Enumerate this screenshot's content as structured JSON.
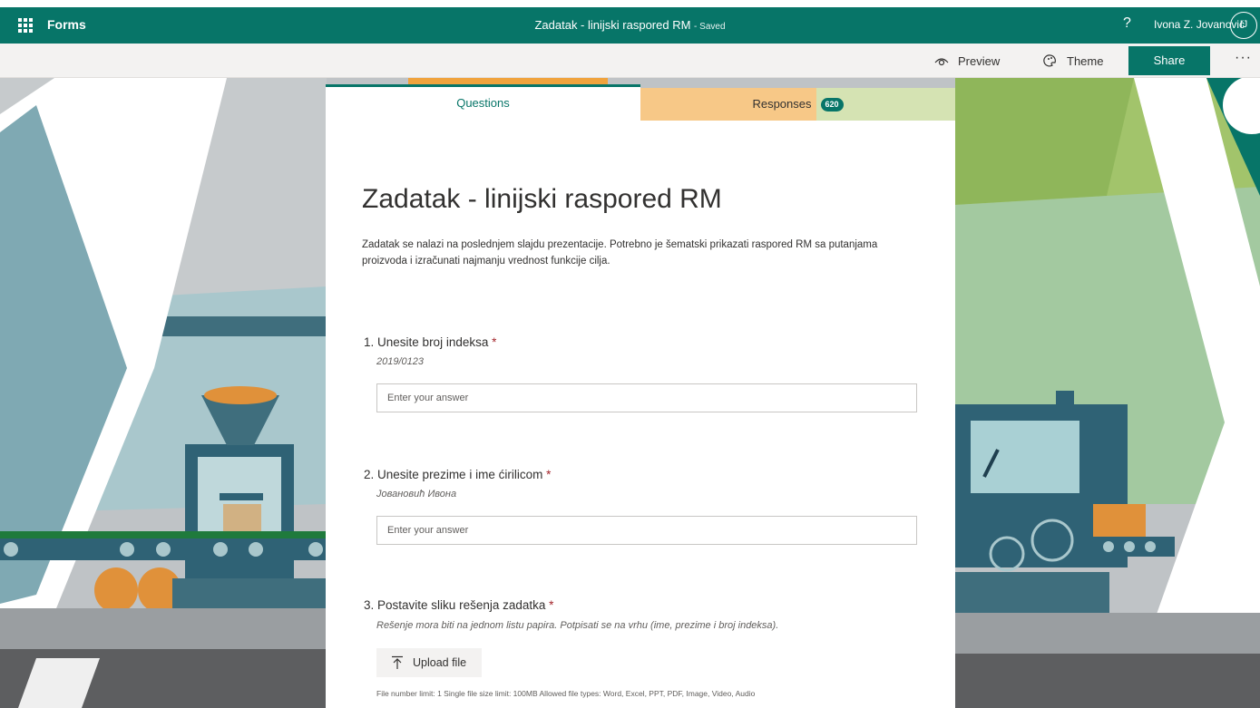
{
  "app": {
    "name": "Forms"
  },
  "document": {
    "title": "Zadatak - linijski raspored RM",
    "status": "- Saved"
  },
  "user": {
    "help": "?",
    "name": "Ivona Z. Jovanović",
    "initials": "IJ"
  },
  "commandbar": {
    "preview": "Preview",
    "theme": "Theme",
    "share": "Share",
    "more": "···"
  },
  "tabs": {
    "questions": "Questions",
    "responses": "Responses",
    "responses_count": "620"
  },
  "form": {
    "title": "Zadatak - linijski raspored RM",
    "description": "Zadatak se nalazi na poslednjem slajdu prezentacije. Potrebno je šematski prikazati raspored RM sa putanjama proizvoda i izračunati najmanju vrednost funkcije cilja.",
    "questions": [
      {
        "number": "1.",
        "title": "Unesite broj indeksa",
        "required": "*",
        "subtitle": "2019/0123",
        "placeholder": "Enter your answer"
      },
      {
        "number": "2.",
        "title": "Unesite prezime i ime ćirilicom",
        "required": "*",
        "subtitle": "Јовановић Ивона",
        "placeholder": "Enter your answer"
      },
      {
        "number": "3.",
        "title": "Postavite sliku rešenja zadatka",
        "required": "*",
        "subtitle": "Rešenje mora biti na jednom listu papira. Potpisati se na vrhu (ime, prezime i broj indeksa).",
        "upload_label": "Upload file",
        "limits": "File number limit: 1   Single file size limit: 100MB   Allowed file types: Word, Excel, PPT, PDF, Image, Video, Audio"
      }
    ]
  },
  "colors": {
    "brand": "#077568",
    "required": "#a4262c"
  }
}
